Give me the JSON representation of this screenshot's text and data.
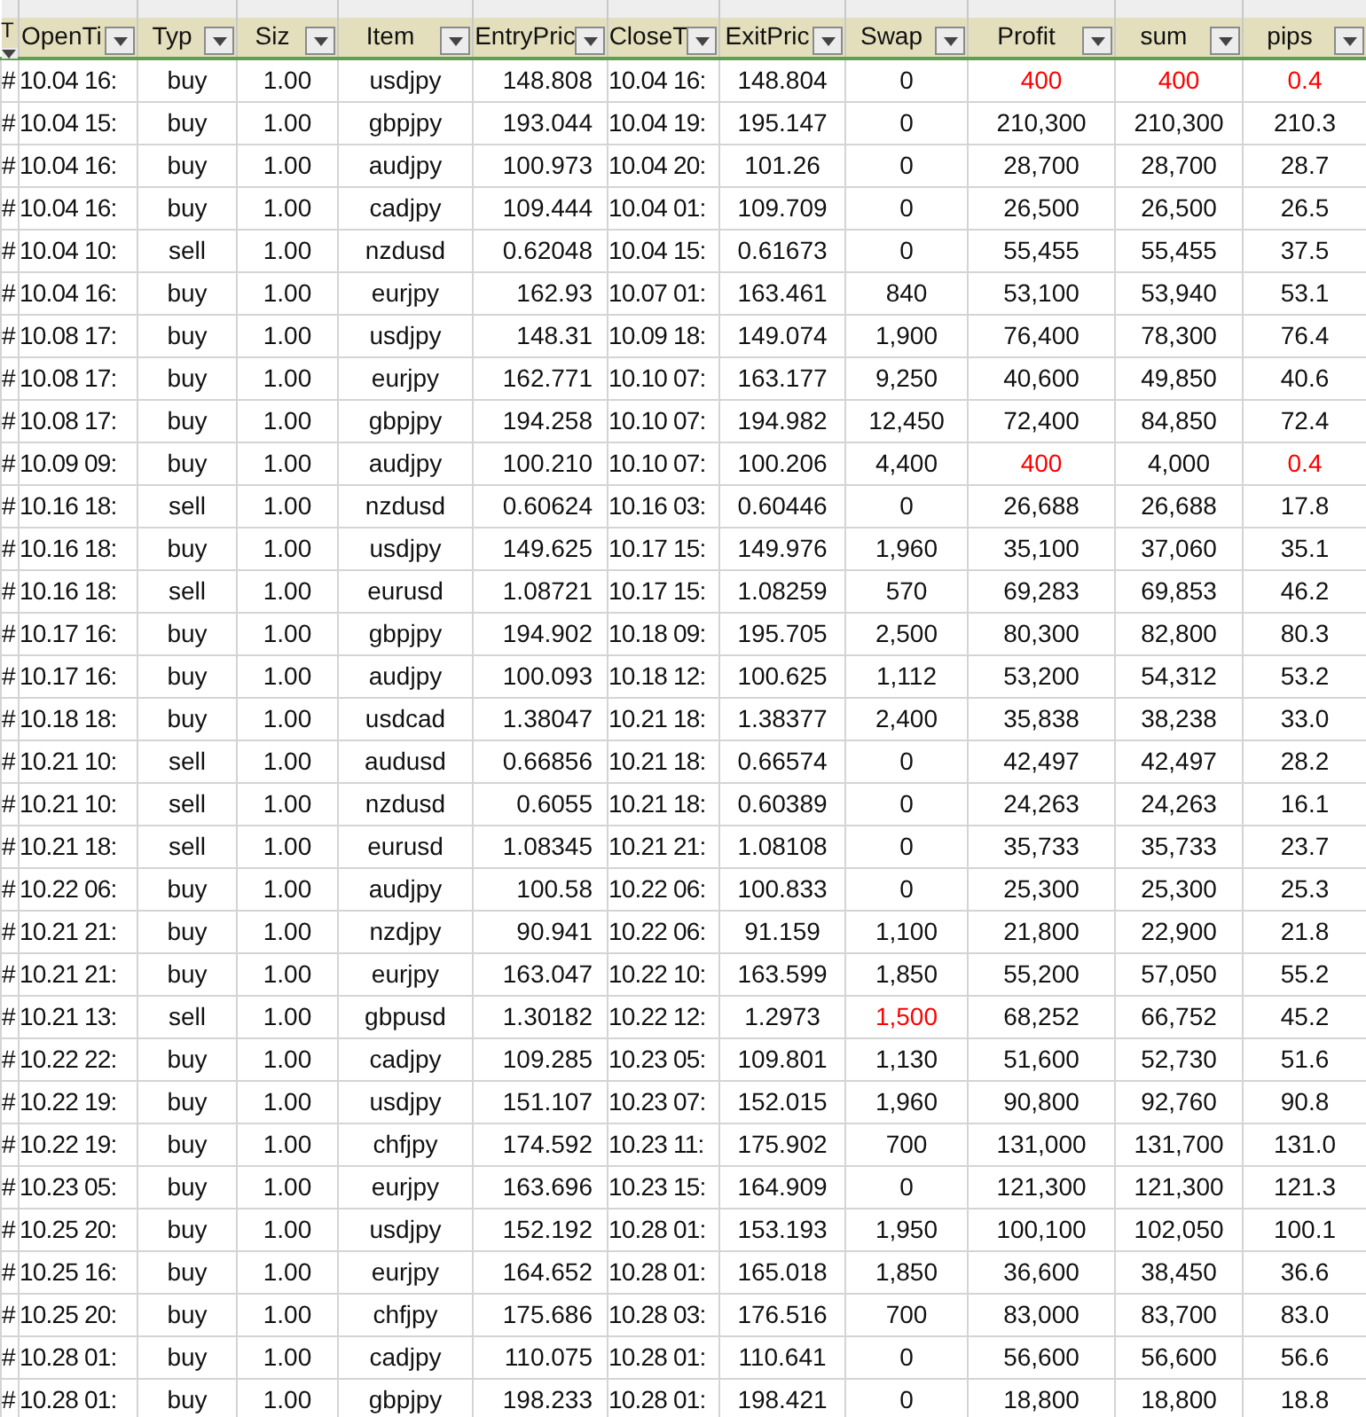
{
  "columns": [
    {
      "label": "T"
    },
    {
      "label": "OpenTi"
    },
    {
      "label": "Typ"
    },
    {
      "label": "Siz"
    },
    {
      "label": "Item"
    },
    {
      "label": "EntryPric"
    },
    {
      "label": "CloseT"
    },
    {
      "label": "ExitPric"
    },
    {
      "label": "Swap"
    },
    {
      "label": "Profit"
    },
    {
      "label": "sum"
    },
    {
      "label": "pips"
    }
  ],
  "rows": [
    {
      "cells": [
        "#",
        "10.04 16:",
        "buy",
        "1.00",
        "usdjpy",
        "148.808",
        "10.04 16:",
        "148.804",
        "0",
        {
          "text": "400",
          "red": true
        },
        {
          "text": "400",
          "red": true
        },
        {
          "text": "0.4",
          "red": true
        }
      ]
    },
    {
      "cells": [
        "#",
        "10.04 15:",
        "buy",
        "1.00",
        "gbpjpy",
        "193.044",
        "10.04 19:",
        "195.147",
        "0",
        "210,300",
        "210,300",
        "210.3"
      ]
    },
    {
      "cells": [
        "#",
        "10.04 16:",
        "buy",
        "1.00",
        "audjpy",
        "100.973",
        "10.04 20:",
        "101.26",
        "0",
        "28,700",
        "28,700",
        "28.7"
      ]
    },
    {
      "cells": [
        "#",
        "10.04 16:",
        "buy",
        "1.00",
        "cadjpy",
        "109.444",
        "10.04 01:",
        "109.709",
        "0",
        "26,500",
        "26,500",
        "26.5"
      ]
    },
    {
      "cells": [
        "#",
        "10.04 10:",
        "sell",
        "1.00",
        "nzdusd",
        "0.62048",
        "10.04 15:",
        "0.61673",
        "0",
        "55,455",
        "55,455",
        "37.5"
      ]
    },
    {
      "cells": [
        "#",
        "10.04 16:",
        "buy",
        "1.00",
        "eurjpy",
        "162.93",
        "10.07 01:",
        "163.461",
        "840",
        "53,100",
        "53,940",
        "53.1"
      ]
    },
    {
      "cells": [
        "#",
        "10.08 17:",
        "buy",
        "1.00",
        "usdjpy",
        "148.31",
        "10.09 18:",
        "149.074",
        "1,900",
        "76,400",
        "78,300",
        "76.4"
      ]
    },
    {
      "cells": [
        "#",
        "10.08 17:",
        "buy",
        "1.00",
        "eurjpy",
        "162.771",
        "10.10 07:",
        "163.177",
        "9,250",
        "40,600",
        "49,850",
        "40.6"
      ]
    },
    {
      "cells": [
        "#",
        "10.08 17:",
        "buy",
        "1.00",
        "gbpjpy",
        "194.258",
        "10.10 07:",
        "194.982",
        "12,450",
        "72,400",
        "84,850",
        "72.4"
      ]
    },
    {
      "cells": [
        "#",
        "10.09 09:",
        "buy",
        "1.00",
        "audjpy",
        "100.210",
        "10.10 07:",
        "100.206",
        "4,400",
        {
          "text": "400",
          "red": true
        },
        "4,000",
        {
          "text": "0.4",
          "red": true
        }
      ]
    },
    {
      "cells": [
        "#",
        "10.16 18:",
        "sell",
        "1.00",
        "nzdusd",
        "0.60624",
        "10.16 03:",
        "0.60446",
        "0",
        "26,688",
        "26,688",
        "17.8"
      ]
    },
    {
      "cells": [
        "#",
        "10.16 18:",
        "buy",
        "1.00",
        "usdjpy",
        "149.625",
        "10.17 15:",
        "149.976",
        "1,960",
        "35,100",
        "37,060",
        "35.1"
      ]
    },
    {
      "cells": [
        "#",
        "10.16 18:",
        "sell",
        "1.00",
        "eurusd",
        "1.08721",
        "10.17 15:",
        "1.08259",
        "570",
        "69,283",
        "69,853",
        "46.2"
      ]
    },
    {
      "cells": [
        "#",
        "10.17 16:",
        "buy",
        "1.00",
        "gbpjpy",
        "194.902",
        "10.18 09:",
        "195.705",
        "2,500",
        "80,300",
        "82,800",
        "80.3"
      ]
    },
    {
      "cells": [
        "#",
        "10.17 16:",
        "buy",
        "1.00",
        "audjpy",
        "100.093",
        "10.18 12:",
        "100.625",
        "1,112",
        "53,200",
        "54,312",
        "53.2"
      ]
    },
    {
      "cells": [
        "#",
        "10.18 18:",
        "buy",
        "1.00",
        "usdcad",
        "1.38047",
        "10.21 18:",
        "1.38377",
        "2,400",
        "35,838",
        "38,238",
        "33.0"
      ]
    },
    {
      "cells": [
        "#",
        "10.21 10:",
        "sell",
        "1.00",
        "audusd",
        "0.66856",
        "10.21 18:",
        "0.66574",
        "0",
        "42,497",
        "42,497",
        "28.2"
      ]
    },
    {
      "cells": [
        "#",
        "10.21 10:",
        "sell",
        "1.00",
        "nzdusd",
        "0.6055",
        "10.21 18:",
        "0.60389",
        "0",
        "24,263",
        "24,263",
        "16.1"
      ]
    },
    {
      "cells": [
        "#",
        "10.21 18:",
        "sell",
        "1.00",
        "eurusd",
        "1.08345",
        "10.21 21:",
        "1.08108",
        "0",
        "35,733",
        "35,733",
        "23.7"
      ]
    },
    {
      "cells": [
        "#",
        "10.22 06:",
        "buy",
        "1.00",
        "audjpy",
        "100.58",
        "10.22 06:",
        "100.833",
        "0",
        "25,300",
        "25,300",
        "25.3"
      ]
    },
    {
      "cells": [
        "#",
        "10.21 21:",
        "buy",
        "1.00",
        "nzdjpy",
        "90.941",
        "10.22 06:",
        "91.159",
        "1,100",
        "21,800",
        "22,900",
        "21.8"
      ]
    },
    {
      "cells": [
        "#",
        "10.21 21:",
        "buy",
        "1.00",
        "eurjpy",
        "163.047",
        "10.22 10:",
        "163.599",
        "1,850",
        "55,200",
        "57,050",
        "55.2"
      ]
    },
    {
      "cells": [
        "#",
        "10.21 13:",
        "sell",
        "1.00",
        "gbpusd",
        "1.30182",
        "10.22 12:",
        "1.2973",
        {
          "text": "1,500",
          "red": true
        },
        "68,252",
        "66,752",
        "45.2"
      ]
    },
    {
      "cells": [
        "#",
        "10.22 22:",
        "buy",
        "1.00",
        "cadjpy",
        "109.285",
        "10.23 05:",
        "109.801",
        "1,130",
        "51,600",
        "52,730",
        "51.6"
      ]
    },
    {
      "cells": [
        "#",
        "10.22 19:",
        "buy",
        "1.00",
        "usdjpy",
        "151.107",
        "10.23 07:",
        "152.015",
        "1,960",
        "90,800",
        "92,760",
        "90.8"
      ]
    },
    {
      "cells": [
        "#",
        "10.22 19:",
        "buy",
        "1.00",
        "chfjpy",
        "174.592",
        "10.23 11:",
        "175.902",
        "700",
        "131,000",
        "131,700",
        "131.0"
      ]
    },
    {
      "cells": [
        "#",
        "10.23 05:",
        "buy",
        "1.00",
        "eurjpy",
        "163.696",
        "10.23 15:",
        "164.909",
        "0",
        "121,300",
        "121,300",
        "121.3"
      ]
    },
    {
      "cells": [
        "#",
        "10.25 20:",
        "buy",
        "1.00",
        "usdjpy",
        "152.192",
        "10.28 01:",
        "153.193",
        "1,950",
        "100,100",
        "102,050",
        "100.1"
      ]
    },
    {
      "cells": [
        "#",
        "10.25 16:",
        "buy",
        "1.00",
        "eurjpy",
        "164.652",
        "10.28 01:",
        "165.018",
        "1,850",
        "36,600",
        "38,450",
        "36.6"
      ]
    },
    {
      "cells": [
        "#",
        "10.25 20:",
        "buy",
        "1.00",
        "chfjpy",
        "175.686",
        "10.28 03:",
        "176.516",
        "700",
        "83,000",
        "83,700",
        "83.0"
      ]
    },
    {
      "cells": [
        "#",
        "10.28 01:",
        "buy",
        "1.00",
        "cadjpy",
        "110.075",
        "10.28 01:",
        "110.641",
        "0",
        "56,600",
        "56,600",
        "56.6"
      ]
    },
    {
      "cells": [
        "#",
        "10.28 01:",
        "buy",
        "1.00",
        "gbpjpy",
        "198.233",
        "10.28 01:",
        "198.421",
        "0",
        "18,800",
        "18,800",
        "18.8"
      ]
    }
  ]
}
